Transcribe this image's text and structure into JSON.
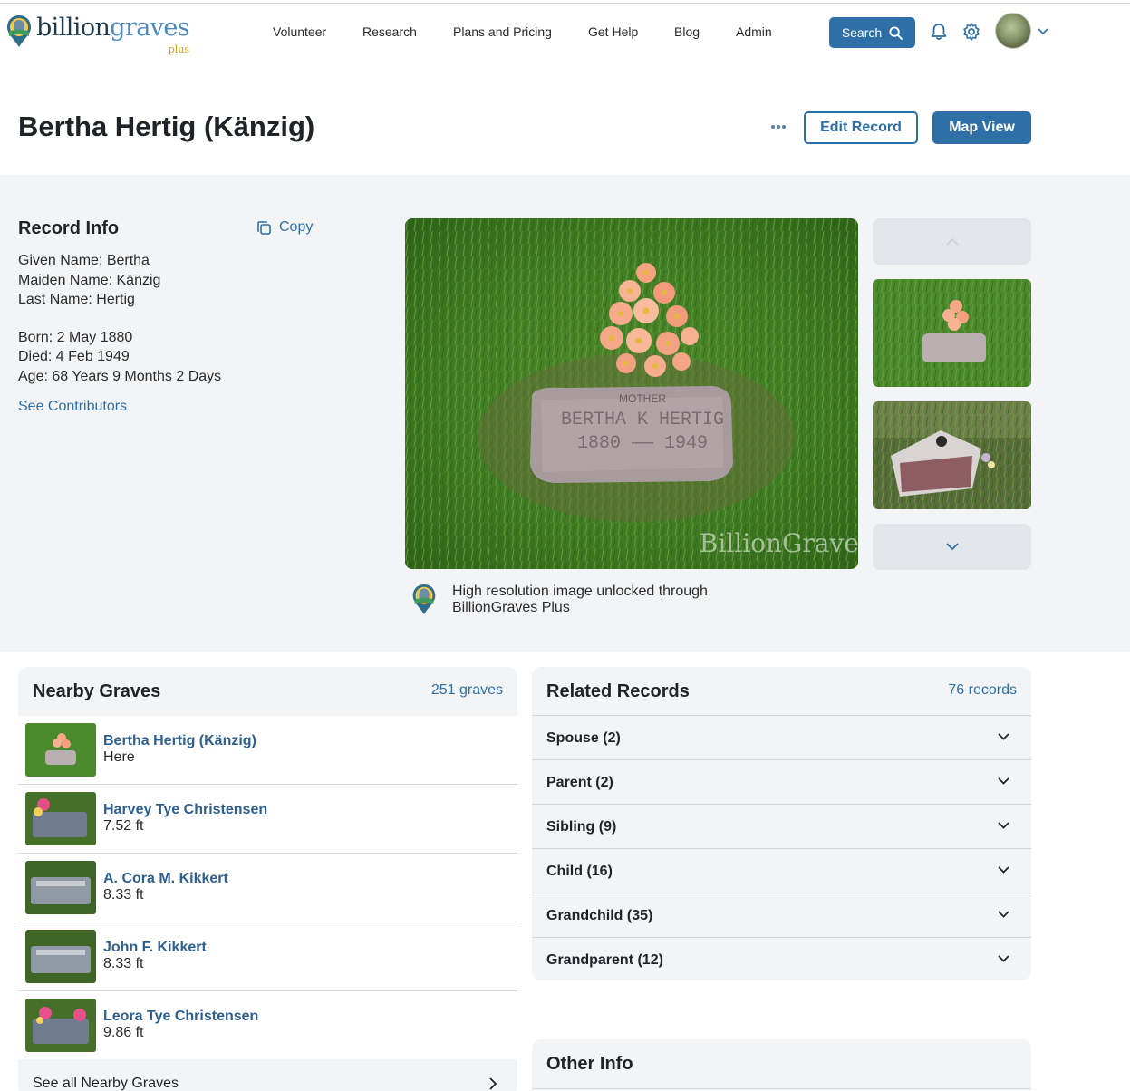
{
  "brand": {
    "name_part1": "billion",
    "name_part2": "graves",
    "plus": "plus",
    "primary_color": "#2e6fa7",
    "link_color": "#2e5f8f"
  },
  "nav": {
    "items": [
      "Volunteer",
      "Research",
      "Plans and Pricing",
      "Get Help",
      "Blog",
      "Admin"
    ],
    "search_label": "Search"
  },
  "header_icons": [
    "search-icon",
    "bell-icon",
    "gear-icon",
    "chevron-down-icon"
  ],
  "record": {
    "title": "Bertha Hertig (Känzig)",
    "edit_label": "Edit Record",
    "map_label": "Map View"
  },
  "record_info": {
    "title": "Record Info",
    "copy_label": "Copy",
    "given_name": "Given Name: Bertha",
    "maiden_name": "Maiden Name: Känzig",
    "last_name": "Last Name: Hertig",
    "born": "Born: 2 May 1880",
    "died": "Died: 4 Feb 1949",
    "age": "Age: 68 Years 9 Months 2 Days",
    "contributors_link": "See Contributors"
  },
  "photo": {
    "stone_line1": "MOTHER",
    "stone_line2": "BERTHA K HERTIG",
    "stone_line3": "1880 —— 1949",
    "watermark": "BillionGraves",
    "hires_note": "High resolution image unlocked through BillionGraves Plus"
  },
  "nearby": {
    "title": "Nearby Graves",
    "count": "251 graves",
    "items": [
      {
        "name": "Bertha Hertig (Känzig)",
        "distance": "Here"
      },
      {
        "name": "Harvey Tye Christensen",
        "distance": "7.52 ft"
      },
      {
        "name": "A. Cora M. Kikkert",
        "distance": "8.33 ft"
      },
      {
        "name": "John F. Kikkert",
        "distance": "8.33 ft"
      },
      {
        "name": "Leora Tye Christensen",
        "distance": "9.86 ft"
      }
    ],
    "see_all": "See all Nearby Graves"
  },
  "related": {
    "title": "Related Records",
    "count": "76 records",
    "items": [
      "Spouse (2)",
      "Parent (2)",
      "Sibling (9)",
      "Child (16)",
      "Grandchild (35)",
      "Grandparent (12)"
    ]
  },
  "other_info": {
    "title": "Other Info"
  }
}
